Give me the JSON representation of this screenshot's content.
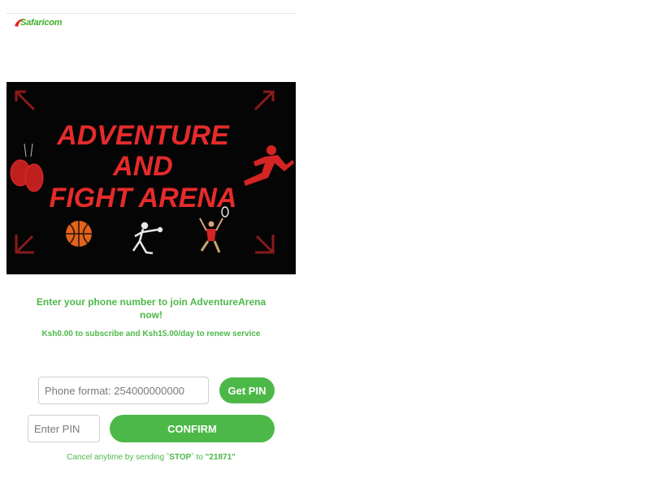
{
  "header": {
    "brand_name": "Safaricom",
    "brand_color": "#3fae29",
    "logo_accent_color": "#e1251b"
  },
  "banner": {
    "title_lines": [
      "ADVENTURE",
      "AND",
      "FIGHT ARENA"
    ],
    "title_color": "#e52b2b",
    "icons": [
      "boxing-gloves-icon",
      "runner-icon",
      "basketball-icon",
      "volleyball-player-icon",
      "badminton-player-icon",
      "corner-arrow-icon"
    ]
  },
  "main": {
    "headline": "Enter your phone number to join AdventureArena now!",
    "pricing": "Ksh0.00 to subscribe and Ksh15.00/day to renew service",
    "accent_color": "#4cb848"
  },
  "form": {
    "phone_placeholder": "Phone format: 254000000000",
    "get_pin_label": "Get PIN",
    "pin_placeholder": "Enter PIN",
    "confirm_label": "CONFIRM"
  },
  "footer": {
    "cancel_prefix": "Cancel anytime by sending ",
    "cancel_keyword": "`STOP`",
    "cancel_middle": " to ",
    "cancel_shortcode": "\"21871\""
  }
}
